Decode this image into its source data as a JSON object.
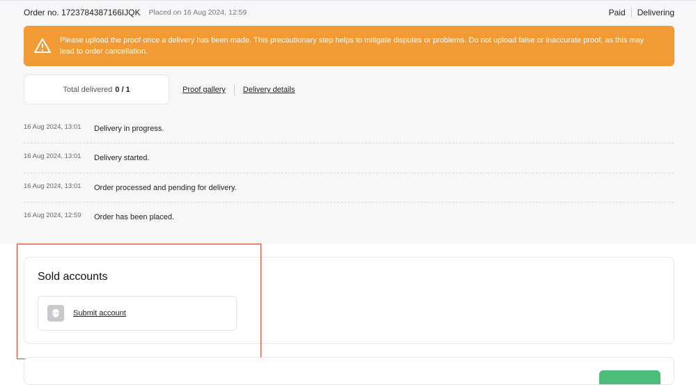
{
  "order": {
    "number_label": "Order no. 1723784387166IJQK",
    "placed_label": "Placed on 16 Aug 2024, 12:59",
    "payment_status": "Paid",
    "delivery_status": "Delivering"
  },
  "alert": {
    "icon": "warning-triangle-icon",
    "text": "Please upload the proof once a delivery has been made. This precautionary step helps to mitigate disputes or problems. Do not upload false or inaccurate proof, as this may lead to order cancellation.",
    "color": "#f29a33"
  },
  "delivery_stat": {
    "label": "Total delivered",
    "value": "0 / 1"
  },
  "links": {
    "proof_gallery": "Proof gallery",
    "delivery_details": "Delivery details"
  },
  "timeline": [
    {
      "time": "16 Aug 2024, 13:01",
      "text": "Delivery in progress."
    },
    {
      "time": "16 Aug 2024, 13:01",
      "text": "Delivery started."
    },
    {
      "time": "16 Aug 2024, 13:01",
      "text": "Order processed and pending for delivery."
    },
    {
      "time": "16 Aug 2024, 12:59",
      "text": "Order has been placed."
    }
  ],
  "sold_accounts": {
    "title": "Sold accounts",
    "submit_label": "Submit account",
    "icon": "account-mask-icon"
  },
  "colors": {
    "highlight": "#e03a2e",
    "accent_green": "#4dbb7a"
  }
}
